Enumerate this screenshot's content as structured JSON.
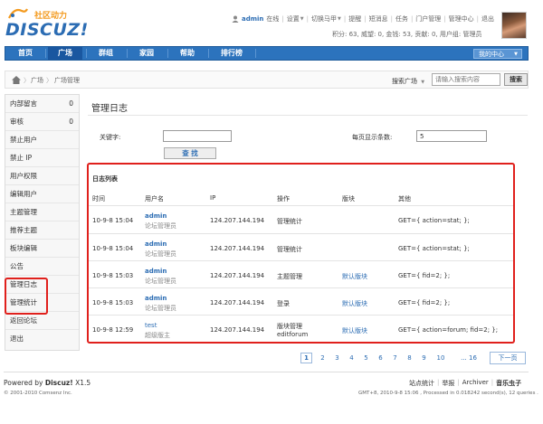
{
  "header": {
    "logo_cn": "社区动力",
    "logo_text": "DISCUZ!",
    "username": "admin",
    "online_status": "在线",
    "links": [
      "设置",
      "切换马甲",
      "提醒",
      "短消息",
      "任务",
      "门户管理",
      "管理中心",
      "退出"
    ],
    "stats": "积分: 63, 威望: 0, 金钱: 53, 贡献: 0, 用户组: 管理员"
  },
  "nav": {
    "items": [
      "首页",
      "广场",
      "群组",
      "家园",
      "帮助",
      "排行榜"
    ],
    "active": "广场",
    "my_center": "我的中心"
  },
  "breadcrumb": {
    "items": [
      "广场",
      "广场管理"
    ],
    "search_label": "搜索广场",
    "search_placeholder": "请输入搜索内容",
    "search_button": "搜索"
  },
  "sidebar": {
    "items": [
      {
        "label": "内部留言",
        "count": "0"
      },
      {
        "label": "审核",
        "count": "0"
      },
      {
        "label": "禁止用户",
        "count": ""
      },
      {
        "label": "禁止 IP",
        "count": ""
      },
      {
        "label": "用户权限",
        "count": ""
      },
      {
        "label": "编辑用户",
        "count": ""
      },
      {
        "label": "主题管理",
        "count": ""
      },
      {
        "label": "推荐主题",
        "count": ""
      },
      {
        "label": "板块编辑",
        "count": ""
      },
      {
        "label": "公告",
        "count": ""
      },
      {
        "label": "管理日志",
        "count": ""
      },
      {
        "label": "管理统计",
        "count": ""
      },
      {
        "label": "返回论坛",
        "count": ""
      },
      {
        "label": "退出",
        "count": ""
      }
    ]
  },
  "main": {
    "title": "管理日志",
    "keyword_label": "关键字:",
    "keyword_value": "",
    "per_page_label": "每页显示条数:",
    "per_page_value": "5",
    "query_button": "查 找",
    "list_title": "日志列表",
    "columns": [
      "时间",
      "用户名",
      "IP",
      "操作",
      "版块",
      "其他"
    ],
    "rows": [
      {
        "time": "10-9-8 15:04",
        "user": "admin",
        "role": "论坛管理员",
        "ip": "124.207.144.194",
        "action": "管理统计",
        "action2": "",
        "forum": "",
        "other": "GET={ action=stat; };"
      },
      {
        "time": "10-9-8 15:04",
        "user": "admin",
        "role": "论坛管理员",
        "ip": "124.207.144.194",
        "action": "管理统计",
        "action2": "",
        "forum": "",
        "other": "GET={ action=stat; };"
      },
      {
        "time": "10-9-8 15:03",
        "user": "admin",
        "role": "论坛管理员",
        "ip": "124.207.144.194",
        "action": "主题管理",
        "action2": "",
        "forum": "默认版块",
        "other": "GET={ fid=2; };"
      },
      {
        "time": "10-9-8 15:03",
        "user": "admin",
        "role": "论坛管理员",
        "ip": "124.207.144.194",
        "action": "登录",
        "action2": "",
        "forum": "默认版块",
        "other": "GET={ fid=2; };"
      },
      {
        "time": "10-9-8 12:59",
        "user": "test",
        "role": "超级版主",
        "ip": "124.207.144.194",
        "action": "版块管理",
        "action2": "editforum",
        "forum": "默认版块",
        "other": "GET={ action=forum; fid=2; };"
      }
    ]
  },
  "pagination": {
    "pages": [
      "1",
      "2",
      "3",
      "4",
      "5",
      "6",
      "7",
      "8",
      "9",
      "10",
      "... 16"
    ],
    "current": "1",
    "next": "下一页"
  },
  "footer": {
    "powered_prefix": "Powered by ",
    "powered_brand": "Discuz!",
    "powered_version": " X1.5",
    "copyright": "© 2001-2010 Comsenz Inc.",
    "links": [
      "站点统计",
      "举报",
      "Archiver",
      "音乐虫子"
    ],
    "info": "GMT+8, 2010-9-8 15:06 , Processed in 0.018242 second(s), 12 queries ."
  },
  "colors": {
    "nav_blue": "#2c73bd",
    "link_blue": "#2b6cb3",
    "highlight_red": "#e0201c"
  }
}
